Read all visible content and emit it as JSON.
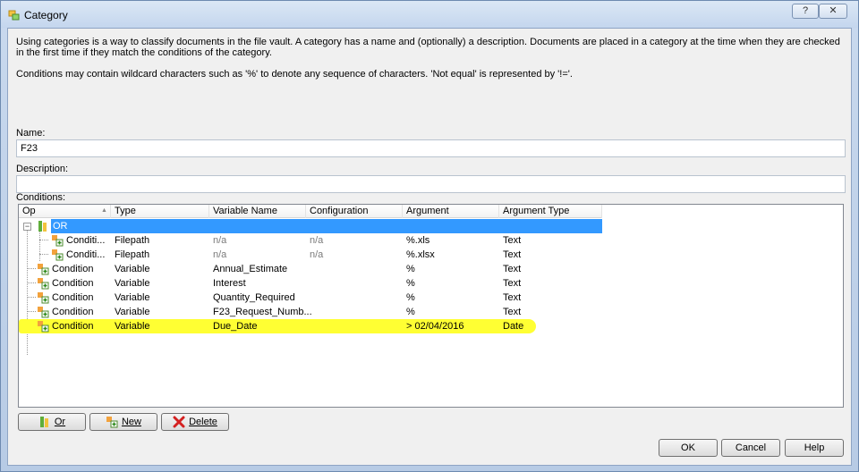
{
  "window": {
    "title": "Category",
    "help_glyph": "?",
    "close_glyph": "✕"
  },
  "intro": {
    "paragraph1": "Using categories is a way to classify documents in the file vault. A category has a name and (optionally) a description. Documents are placed in a category at the time when they are checked in the first time if they match the conditions of the category.",
    "paragraph2": "Conditions may contain wildcard characters such as '%' to denote any sequence of characters. 'Not equal' is represented by '!='."
  },
  "form": {
    "name_label": "Name:",
    "name_value": "F23",
    "description_label": "Description:",
    "description_value": "",
    "conditions_label": "Conditions:"
  },
  "grid": {
    "columns": [
      "Op",
      "Type",
      "Variable Name",
      "Configuration",
      "Argument",
      "Argument Type"
    ],
    "sort_glyph": "▲",
    "rows": [
      {
        "op": "OR",
        "type": "",
        "variable": "",
        "config": "",
        "argument": "",
        "arg_type": ""
      },
      {
        "op": "Conditi...",
        "type": "Filepath",
        "variable": "n/a",
        "config": "n/a",
        "argument": "%.xls",
        "arg_type": "Text"
      },
      {
        "op": "Conditi...",
        "type": "Filepath",
        "variable": "n/a",
        "config": "n/a",
        "argument": "%.xlsx",
        "arg_type": "Text"
      },
      {
        "op": "Condition",
        "type": "Variable",
        "variable": "Annual_Estimate",
        "config": "",
        "argument": "%",
        "arg_type": "Text"
      },
      {
        "op": "Condition",
        "type": "Variable",
        "variable": "Interest",
        "config": "",
        "argument": "%",
        "arg_type": "Text"
      },
      {
        "op": "Condition",
        "type": "Variable",
        "variable": "Quantity_Required",
        "config": "",
        "argument": "%",
        "arg_type": "Text"
      },
      {
        "op": "Condition",
        "type": "Variable",
        "variable": "F23_Request_Numb...",
        "config": "",
        "argument": "%",
        "arg_type": "Text"
      },
      {
        "op": "Condition",
        "type": "Variable",
        "variable": "Due_Date",
        "config": "",
        "argument": "> 02/04/2016",
        "arg_type": "Date"
      }
    ]
  },
  "buttons": {
    "or": "Or",
    "new": "New",
    "delete": "Delete",
    "ok": "OK",
    "cancel": "Cancel",
    "help": "Help"
  },
  "colors": {
    "selection": "#3399ff",
    "highlight": "#ffff33"
  }
}
